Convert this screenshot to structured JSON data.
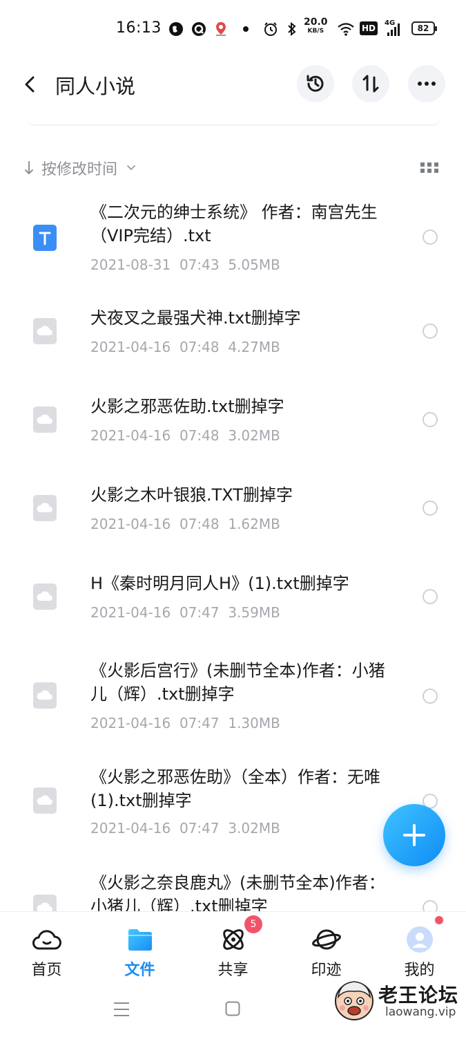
{
  "status_bar": {
    "time": "16:13",
    "net_speed": "20.0",
    "net_unit": "KB/S",
    "hd_label": "HD",
    "signal_label": "4G",
    "battery": "82"
  },
  "header": {
    "title": "同人小说",
    "icons": [
      "back-icon",
      "history-icon",
      "sort-icon",
      "more-icon"
    ]
  },
  "sort": {
    "label": "按修改时间"
  },
  "files": [
    {
      "name": "《二次元的绅士系统》 作者：南宫先生（VIP完结）.txt",
      "date": "2021-08-31",
      "time": "07:43",
      "size": "5.05MB",
      "type": "txt"
    },
    {
      "name": "犬夜叉之最强犬神.txt删掉字",
      "date": "2021-04-16",
      "time": "07:48",
      "size": "4.27MB",
      "type": "cloud"
    },
    {
      "name": "火影之邪恶佐助.txt删掉字",
      "date": "2021-04-16",
      "time": "07:48",
      "size": "3.02MB",
      "type": "cloud"
    },
    {
      "name": "火影之木叶银狼.TXT删掉字",
      "date": "2021-04-16",
      "time": "07:48",
      "size": "1.62MB",
      "type": "cloud"
    },
    {
      "name": "H《秦时明月同人H》(1).txt删掉字",
      "date": "2021-04-16",
      "time": "07:47",
      "size": "3.59MB",
      "type": "cloud"
    },
    {
      "name": "《火影后宫行》(未删节全本)作者：小猪儿（辉）.txt删掉字",
      "date": "2021-04-16",
      "time": "07:47",
      "size": "1.30MB",
      "type": "cloud"
    },
    {
      "name": "《火影之邪恶佐助》（全本）作者：无唯(1).txt删掉字",
      "date": "2021-04-16",
      "time": "07:47",
      "size": "3.02MB",
      "type": "cloud"
    },
    {
      "name": "《火影之奈良鹿丸》(未删节全本)作者：小猪儿（辉）.txt删掉字",
      "date": "",
      "time": "",
      "size": "",
      "type": "cloud"
    }
  ],
  "bottom_nav": [
    {
      "label": "首页",
      "icon": "cloud-home-icon",
      "active": false
    },
    {
      "label": "文件",
      "icon": "folder-icon",
      "active": true
    },
    {
      "label": "共享",
      "icon": "atom-share-icon",
      "active": false,
      "badge": "5"
    },
    {
      "label": "印迹",
      "icon": "planet-icon",
      "active": false
    },
    {
      "label": "我的",
      "icon": "avatar-icon",
      "active": false,
      "dot": true
    }
  ],
  "watermark": {
    "title": "老王论坛",
    "url": "laowang.vip"
  },
  "colors": {
    "accent": "#1a8cf0",
    "txt_icon": "#3a8ef6",
    "badge": "#f0546b"
  }
}
